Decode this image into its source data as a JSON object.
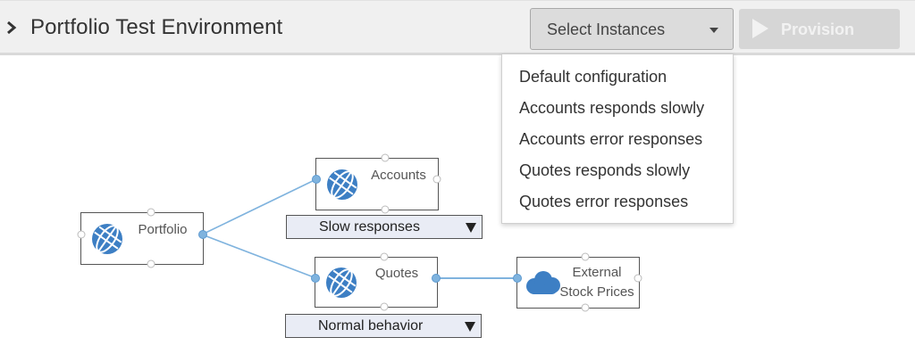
{
  "header": {
    "title": "Portfolio Test Environment",
    "select_label": "Select Instances",
    "provision_label": "Provision"
  },
  "instances_menu": {
    "options": [
      "Default configuration",
      "Accounts responds slowly",
      "Accounts error responses",
      "Quotes responds slowly",
      "Quotes error responses"
    ]
  },
  "diagram": {
    "nodes": {
      "portfolio": {
        "label": "Portfolio",
        "icon": "globe-icon"
      },
      "accounts": {
        "label": "Accounts",
        "icon": "globe-icon",
        "behavior": "Slow responses"
      },
      "quotes": {
        "label": "Quotes",
        "icon": "globe-icon",
        "behavior": "Normal behavior"
      },
      "external": {
        "label": "External\nStock Prices",
        "icon": "cloud-icon"
      }
    }
  },
  "colors": {
    "connector": "#7fb3de",
    "icon_blue": "#3d7fc4",
    "dropdown_bg": "#e9ecf5"
  }
}
